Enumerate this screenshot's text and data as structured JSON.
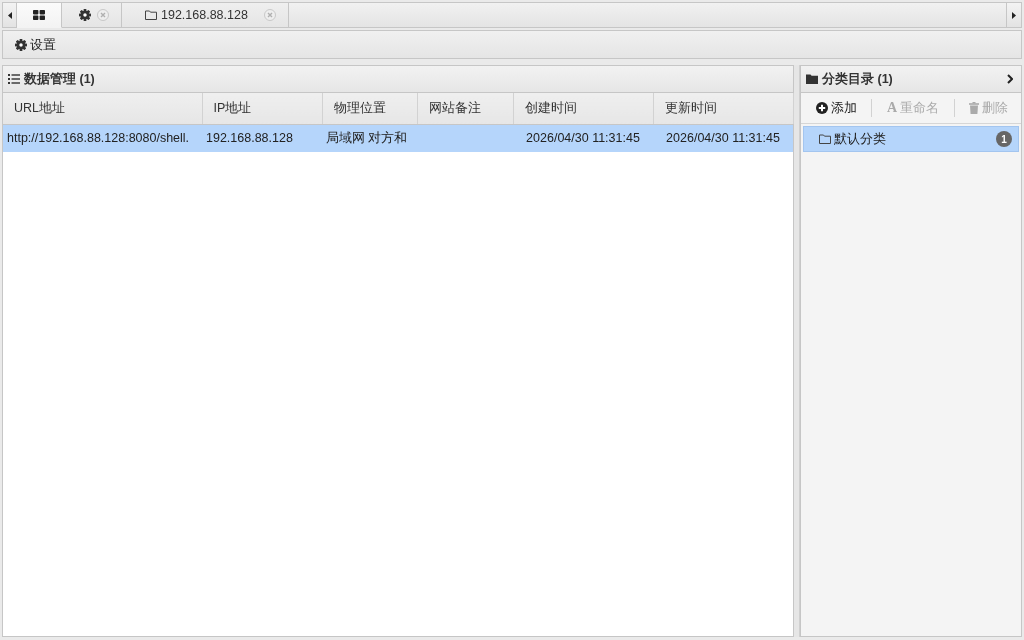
{
  "tab_bar": {
    "tabs": [
      {
        "kind": "home",
        "selected": true,
        "closable": false
      },
      {
        "kind": "settings",
        "selected": false,
        "closable": true
      },
      {
        "kind": "folder",
        "label": "192.168.88.128",
        "selected": false,
        "closable": true
      }
    ]
  },
  "toolbar": {
    "buttons": [
      {
        "kind": "settings",
        "label": "设置"
      }
    ]
  },
  "data_panel": {
    "title": "数据管理 (1)",
    "table": {
      "columns": [
        "URL地址",
        "IP地址",
        "物理位置",
        "网站备注",
        "创建时间",
        "更新时间"
      ],
      "rows": [
        {
          "selected": true,
          "cells": [
            "http://192.168.88.128:8080/shell.",
            "192.168.88.128",
            "局域网 对方和",
            "",
            "2026/04/30 11:31:45",
            "2026/04/30 11:31:45"
          ]
        }
      ]
    }
  },
  "category_panel": {
    "title": "分类目录 (1)",
    "actions": [
      {
        "kind": "add",
        "label": "添加",
        "disabled": false
      },
      {
        "kind": "rename",
        "icon_text": "A",
        "label": "重命名",
        "disabled": true
      },
      {
        "kind": "delete",
        "label": "删除",
        "disabled": true
      }
    ],
    "tree": [
      {
        "label": "默认分类",
        "count": "1",
        "selected": true
      }
    ]
  }
}
